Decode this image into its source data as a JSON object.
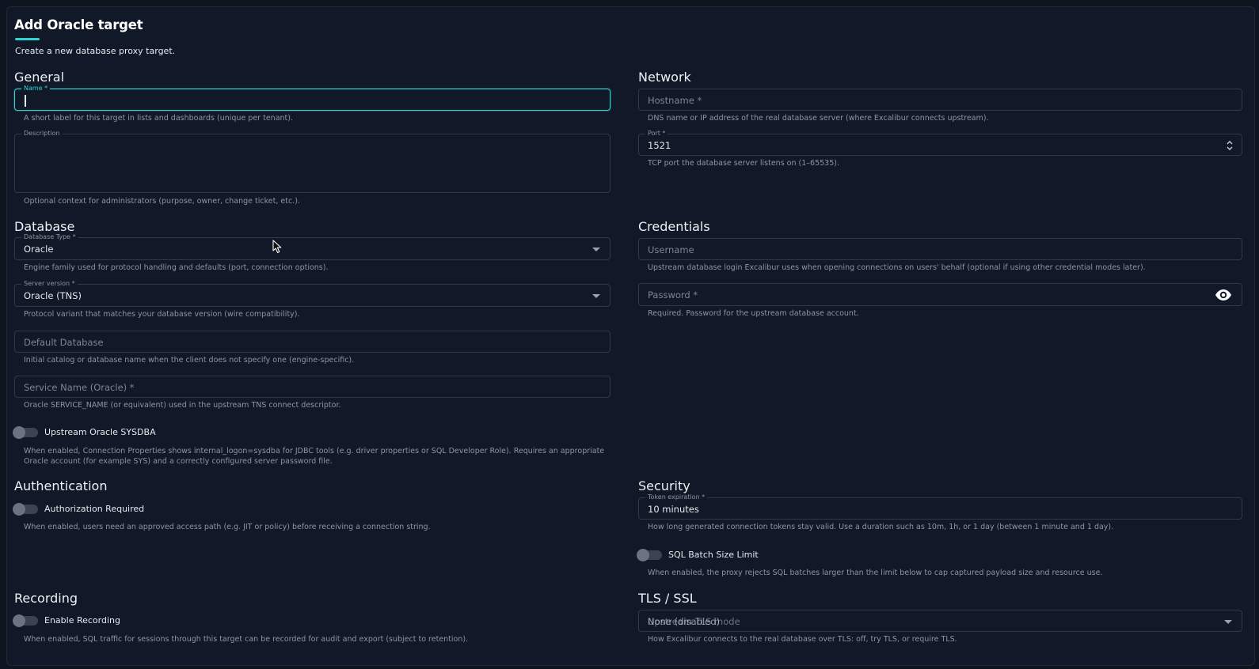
{
  "header": {
    "title": "Add Oracle target",
    "subtitle": "Create a new database proxy target."
  },
  "sections": {
    "general": "General",
    "network": "Network",
    "database": "Database",
    "credentials": "Credentials",
    "authentication": "Authentication",
    "security": "Security",
    "recording": "Recording",
    "tls": "TLS / SSL"
  },
  "general": {
    "name": {
      "label": "Name *",
      "value": "",
      "help": "A short label for this target in lists and dashboards (unique per tenant)."
    },
    "description": {
      "label": "Description",
      "value": "",
      "help": "Optional context for administrators (purpose, owner, change ticket, etc.)."
    }
  },
  "network": {
    "hostname": {
      "placeholder": "Hostname *",
      "help": "DNS name or IP address of the real database server (where Excalibur connects upstream)."
    },
    "port": {
      "label": "Port *",
      "value": "1521",
      "help": "TCP port the database server listens on (1–65535)."
    }
  },
  "database": {
    "db_type": {
      "label": "Database Type *",
      "value": "Oracle",
      "help": "Engine family used for protocol handling and defaults (port, connection options)."
    },
    "server_version": {
      "label": "Server version *",
      "value": "Oracle (TNS)",
      "help": "Protocol variant that matches your database version (wire compatibility)."
    },
    "default_db": {
      "placeholder": "Default Database",
      "help": "Initial catalog or database name when the client does not specify one (engine-specific)."
    },
    "service_name": {
      "placeholder": "Service Name (Oracle) *",
      "help": "Oracle SERVICE_NAME (or equivalent) used in the upstream TNS connect descriptor."
    },
    "sysdba": {
      "label": "Upstream Oracle SYSDBA",
      "enabled": false,
      "help_line1": "When enabled, Connection Properties shows internal_logon=sysdba for JDBC tools (e.g. driver properties or SQL Developer Role). Requires an appropriate",
      "help_line2": "Oracle account (for example SYS) and a correctly configured server password file."
    }
  },
  "credentials": {
    "username": {
      "placeholder": "Username",
      "help": "Upstream database login Excalibur uses when opening connections on users' behalf (optional if using other credential modes later)."
    },
    "password": {
      "placeholder": "Password *",
      "help": "Required. Password for the upstream database account."
    }
  },
  "authentication": {
    "auth_required": {
      "label": "Authorization Required",
      "enabled": false,
      "help": "When enabled, users need an approved access path (e.g. JIT or policy) before receiving a connection string."
    }
  },
  "security": {
    "token_expiration": {
      "label": "Token expiration *",
      "value": "10 minutes",
      "help": "How long generated connection tokens stay valid. Use a duration such as 10m, 1h, or 1 day (between 1 minute and 1 day)."
    },
    "sql_batch": {
      "label": "SQL Batch Size Limit",
      "enabled": false,
      "help": "When enabled, the proxy rejects SQL batches larger than the limit below to cap captured payload size and resource use."
    }
  },
  "recording": {
    "enable": {
      "label": "Enable Recording",
      "enabled": false,
      "help": "When enabled, SQL traffic for sessions through this target can be recorded for audit and export (subject to retention)."
    }
  },
  "tls": {
    "mode": {
      "label": "Upstream TLS mode",
      "value": "None (disabled)",
      "help": "How Excalibur connects to the real database over TLS: off, try TLS, or require TLS."
    }
  },
  "colors": {
    "accent": "#2dd4d4",
    "background": "#111827",
    "border": "#2f3947"
  }
}
